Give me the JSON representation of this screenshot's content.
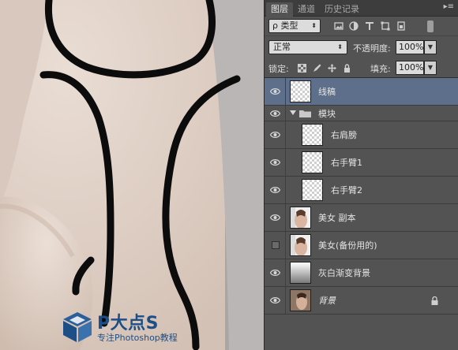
{
  "panel": {
    "tabs": [
      {
        "label": "图层",
        "active": true
      },
      {
        "label": "通道",
        "active": false
      },
      {
        "label": "历史记录",
        "active": false
      }
    ],
    "filter": {
      "kind_label": "ρ 类型",
      "icons": [
        "image-filter-icon",
        "adjustment-filter-icon",
        "text-filter-icon",
        "shape-filter-icon",
        "smart-object-filter-icon"
      ]
    },
    "blend": {
      "mode": "正常",
      "opacity_label": "不透明度:",
      "opacity_value": "100%"
    },
    "lock": {
      "label": "锁定:",
      "fill_label": "填充:",
      "fill_value": "100%"
    },
    "layers": [
      {
        "name": "线稿",
        "type": "layer",
        "thumb": "transparent",
        "visible": true,
        "selected": true,
        "indent": false
      },
      {
        "name": "模块",
        "type": "group",
        "visible": true,
        "selected": false
      },
      {
        "name": "右肩膀",
        "type": "layer",
        "thumb": "transparent",
        "visible": true,
        "selected": false,
        "indent": true
      },
      {
        "name": "右手臂1",
        "type": "layer",
        "thumb": "transparent",
        "visible": true,
        "selected": false,
        "indent": true
      },
      {
        "name": "右手臂2",
        "type": "layer",
        "thumb": "transparent",
        "visible": true,
        "selected": false,
        "indent": true
      },
      {
        "name": "美女 副本",
        "type": "layer",
        "thumb": "photo",
        "visible": true,
        "selected": false,
        "indent": false
      },
      {
        "name": "美女(备份用的)",
        "type": "layer",
        "thumb": "photo",
        "visible": false,
        "selected": false,
        "indent": false
      },
      {
        "name": "灰白渐变背景",
        "type": "layer",
        "thumb": "gradient",
        "visible": true,
        "selected": false,
        "indent": false
      },
      {
        "name": "背景",
        "type": "layer",
        "thumb": "photo2",
        "visible": true,
        "selected": false,
        "indent": false,
        "italic": true,
        "locked": true
      }
    ]
  },
  "watermark": {
    "title": "P大点S",
    "subtitle": "专注Photoshop教程",
    "color": "#1d4e86"
  },
  "colors": {
    "selected": "#5d6f8a",
    "panel": "#535353",
    "skin": "#e2d3c9"
  }
}
